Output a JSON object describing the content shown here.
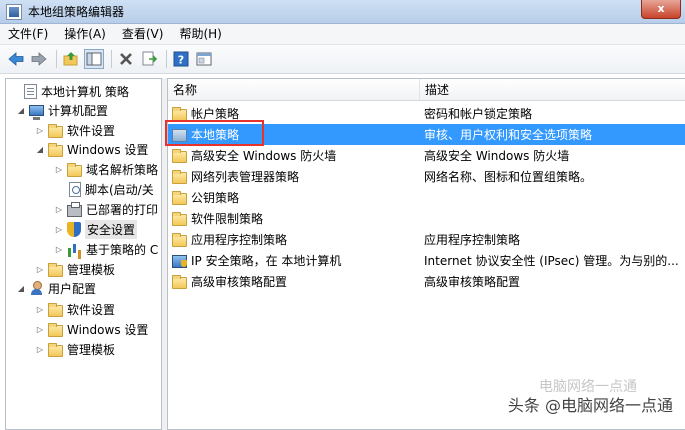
{
  "window": {
    "title": "本地组策略编辑器",
    "close_label": "x"
  },
  "menu": [
    "文件(F)",
    "操作(A)",
    "查看(V)",
    "帮助(H)"
  ],
  "toolbar": {
    "icons": [
      "back-arrow-icon",
      "forward-arrow-icon",
      "up-folder-icon",
      "show-tree-icon",
      "delete-icon",
      "export-icon",
      "help-icon",
      "properties-icon"
    ]
  },
  "tree": [
    {
      "label": "本地计算机 策略",
      "icon": "root",
      "indent": 0,
      "expander": ""
    },
    {
      "label": "计算机配置",
      "icon": "pc",
      "indent": 1,
      "expander": "◢"
    },
    {
      "label": "软件设置",
      "icon": "folder",
      "indent": 2,
      "expander": "▷"
    },
    {
      "label": "Windows 设置",
      "icon": "folder",
      "indent": 2,
      "expander": "◢"
    },
    {
      "label": "域名解析策略",
      "icon": "folder",
      "indent": 3,
      "expander": "▷"
    },
    {
      "label": "脚本(启动/关",
      "icon": "script",
      "indent": 3,
      "expander": ""
    },
    {
      "label": "已部署的打印",
      "icon": "printer",
      "indent": 3,
      "expander": "▷"
    },
    {
      "label": "安全设置",
      "icon": "shield",
      "indent": 3,
      "expander": "▷",
      "selected": true
    },
    {
      "label": "基于策略的 C",
      "icon": "chart",
      "indent": 3,
      "expander": "▷"
    },
    {
      "label": "管理模板",
      "icon": "folder",
      "indent": 2,
      "expander": "▷"
    },
    {
      "label": "用户配置",
      "icon": "user",
      "indent": 1,
      "expander": "◢"
    },
    {
      "label": "软件设置",
      "icon": "folder",
      "indent": 2,
      "expander": "▷"
    },
    {
      "label": "Windows 设置",
      "icon": "folder",
      "indent": 2,
      "expander": "▷"
    },
    {
      "label": "管理模板",
      "icon": "folder",
      "indent": 2,
      "expander": "▷"
    }
  ],
  "list": {
    "columns": [
      "名称",
      "描述"
    ],
    "rows": [
      {
        "name": "帐户策略",
        "desc": "密码和帐户锁定策略",
        "icon": "folder"
      },
      {
        "name": "本地策略",
        "desc": "审核、用户权利和安全选项策略",
        "icon": "folder",
        "selected": true
      },
      {
        "name": "高级安全 Windows 防火墙",
        "desc": "高级安全 Windows 防火墙",
        "icon": "folder"
      },
      {
        "name": "网络列表管理器策略",
        "desc": "网络名称、图标和位置组策略。",
        "icon": "folder"
      },
      {
        "name": "公钥策略",
        "desc": "",
        "icon": "folder"
      },
      {
        "name": "软件限制策略",
        "desc": "",
        "icon": "folder"
      },
      {
        "name": "应用程序控制策略",
        "desc": "应用程序控制策略",
        "icon": "folder"
      },
      {
        "name": "IP 安全策略，在 本地计算机",
        "desc": "Internet 协议安全性 (IPsec) 管理。为与别的...",
        "icon": "ip"
      },
      {
        "name": "高级审核策略配置",
        "desc": "高级审核策略配置",
        "icon": "folder"
      }
    ]
  },
  "watermark": {
    "main": "头条 @电脑网络一点通",
    "faint": "电脑网络一点通"
  },
  "colors": {
    "selection": "#3399ff",
    "highlight_box": "#e8322b"
  }
}
